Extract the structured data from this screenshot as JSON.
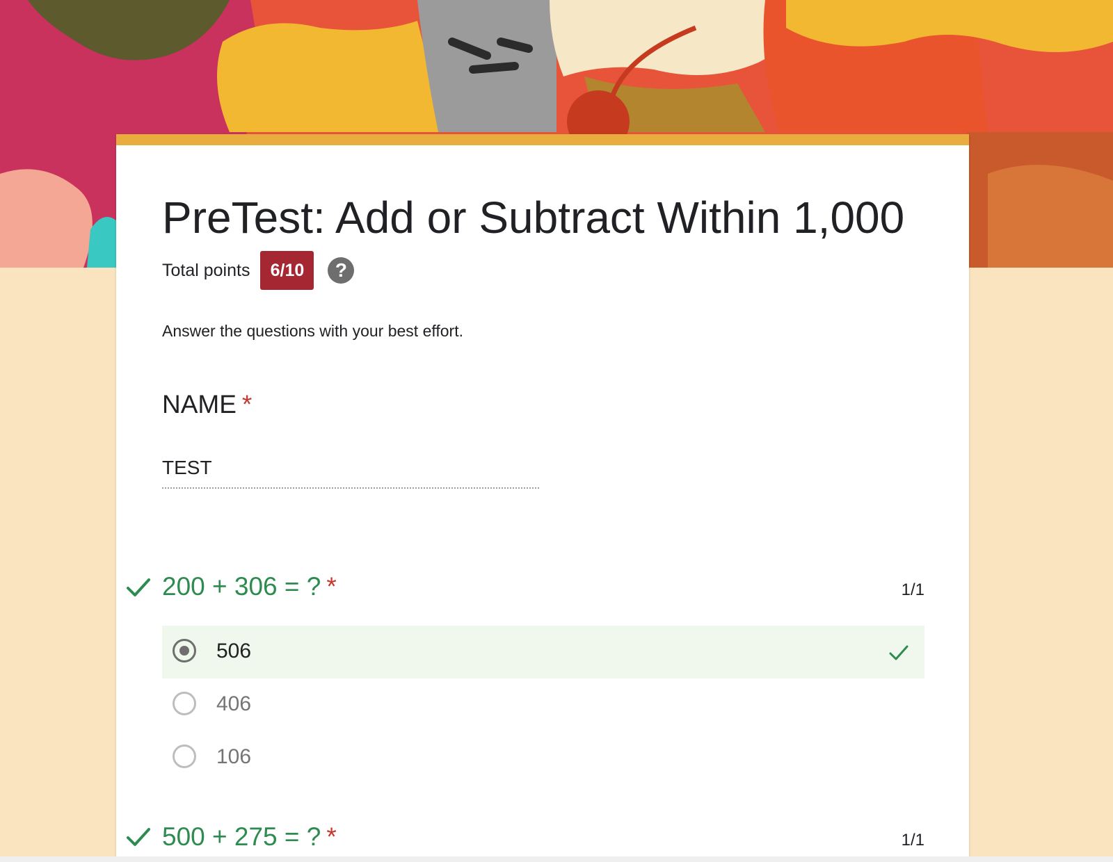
{
  "header": {
    "banner_palette": [
      "#c9325c",
      "#e8543a",
      "#f3b832",
      "#5d5a2e",
      "#f6e8c6",
      "#9b9b9b",
      "#c95a2c",
      "#f4a795",
      "#39c8c2"
    ]
  },
  "form": {
    "accent_color": "#e8ad3e",
    "title": "PreTest: Add or Subtract Within 1,000",
    "total_points_label": "Total points",
    "score_badge": "6/10",
    "help_icon": "?",
    "description": "Answer the questions with your best effort."
  },
  "questions": {
    "name": {
      "title": "NAME",
      "required_mark": "*",
      "answer": "TEST"
    },
    "q1": {
      "title": "200 + 306 = ?",
      "required_mark": "*",
      "score": "1/1",
      "correct": true,
      "options": [
        {
          "label": "506",
          "selected": true,
          "correct": true
        },
        {
          "label": "406",
          "selected": false
        },
        {
          "label": "106",
          "selected": false
        }
      ]
    },
    "q2": {
      "title": "500 + 275 = ?",
      "required_mark": "*",
      "score": "1/1",
      "correct": true
    }
  },
  "colors": {
    "correct_green": "#2e8b4f",
    "badge_red": "#a52731",
    "required_red": "#c5392c",
    "page_background": "#f9e4bf",
    "selected_option_bg": "#f0f7ed"
  }
}
